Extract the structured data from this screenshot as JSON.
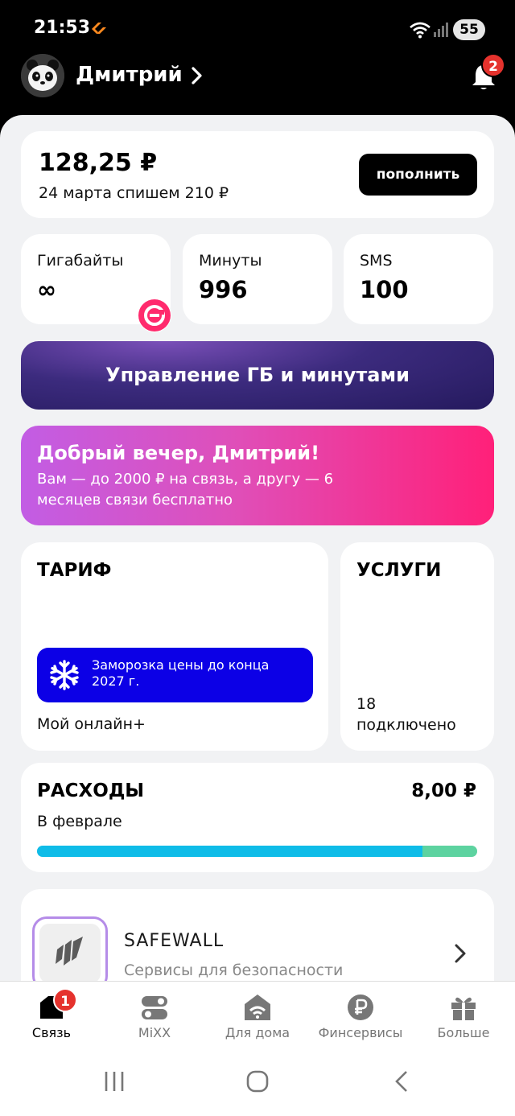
{
  "status_bar": {
    "time": "21:53",
    "battery": "55"
  },
  "header": {
    "user_name": "Дмитрий",
    "notifications_count": "2"
  },
  "balance": {
    "amount": "128,25 ₽",
    "next_charge": "24 марта спишем 210 ₽",
    "topup_label": "пополнить"
  },
  "remains": [
    {
      "label": "Гигабайты",
      "value": "∞"
    },
    {
      "label": "Минуты",
      "value": "996"
    },
    {
      "label": "SMS",
      "value": "100"
    }
  ],
  "manage_button": "Управление ГБ и минутами",
  "promo": {
    "title": "Добрый вечер, Дмитрий!",
    "text": "Вам — до 2000 ₽ на связь, а другу — 6 месяцев связи бесплатно"
  },
  "tariff": {
    "heading": "ТАРИФ",
    "freeze_text": "Заморозка цены до конца 2027 г.",
    "name": "Мой онлайн+"
  },
  "services": {
    "heading": "УСЛУГИ",
    "count": "18",
    "count_label": "подключено"
  },
  "expenses": {
    "heading": "РАСХОДЫ",
    "amount": "8,00 ₽",
    "month": "В феврале",
    "bar_fraction": 0.875
  },
  "safewall": {
    "title": "SAFEWALL",
    "subtitle": "Сервисы для безопасности"
  },
  "bottom_nav": [
    {
      "label": "Связь",
      "icon": "phone-card-icon",
      "badge": "1",
      "active": true
    },
    {
      "label": "MiXX",
      "icon": "mixx-icon"
    },
    {
      "label": "Для дома",
      "icon": "home-wifi-icon"
    },
    {
      "label": "Финсервисы",
      "icon": "ruble-icon"
    },
    {
      "label": "Больше",
      "icon": "gift-icon"
    }
  ],
  "colors": {
    "accent_blue": "#0c00e6",
    "promo_pink": "#ff2079",
    "badge_red": "#e5322d",
    "bar_blue": "#0fbce8",
    "bar_green": "#5dd3a0"
  }
}
